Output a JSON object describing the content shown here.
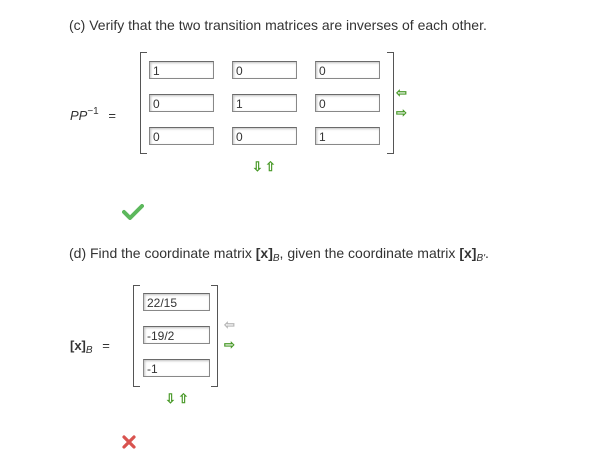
{
  "part_c": {
    "prompt": "(c) Verify that the two transition matrices are inverses of each other.",
    "lhs_main": "PP",
    "lhs_exp": "−1",
    "equals": "=",
    "matrix": [
      [
        "1",
        "0",
        "0"
      ],
      [
        "0",
        "1",
        "0"
      ],
      [
        "0",
        "0",
        "1"
      ]
    ],
    "status": "correct",
    "status_icon": "checkmark-icon",
    "status_color": "#5cb85c"
  },
  "part_d": {
    "prompt_pre": "(d) Find the coordinate matrix ",
    "x1": "[x]",
    "sub1": "B",
    "prompt_mid": ", given the coordinate matrix ",
    "x2": "[x]",
    "sub2": "B'",
    "prompt_end": ".",
    "lhs_x": "[x]",
    "lhs_sub": "B",
    "equals": "=",
    "vector": [
      "22/15",
      "-19/2",
      "-1"
    ],
    "status": "incorrect",
    "status_icon": "x-mark-icon",
    "status_color": "#d9534f"
  },
  "colors": {
    "arrow_active": "#4a9a2a",
    "arrow_inactive": "#b7b7b7"
  }
}
